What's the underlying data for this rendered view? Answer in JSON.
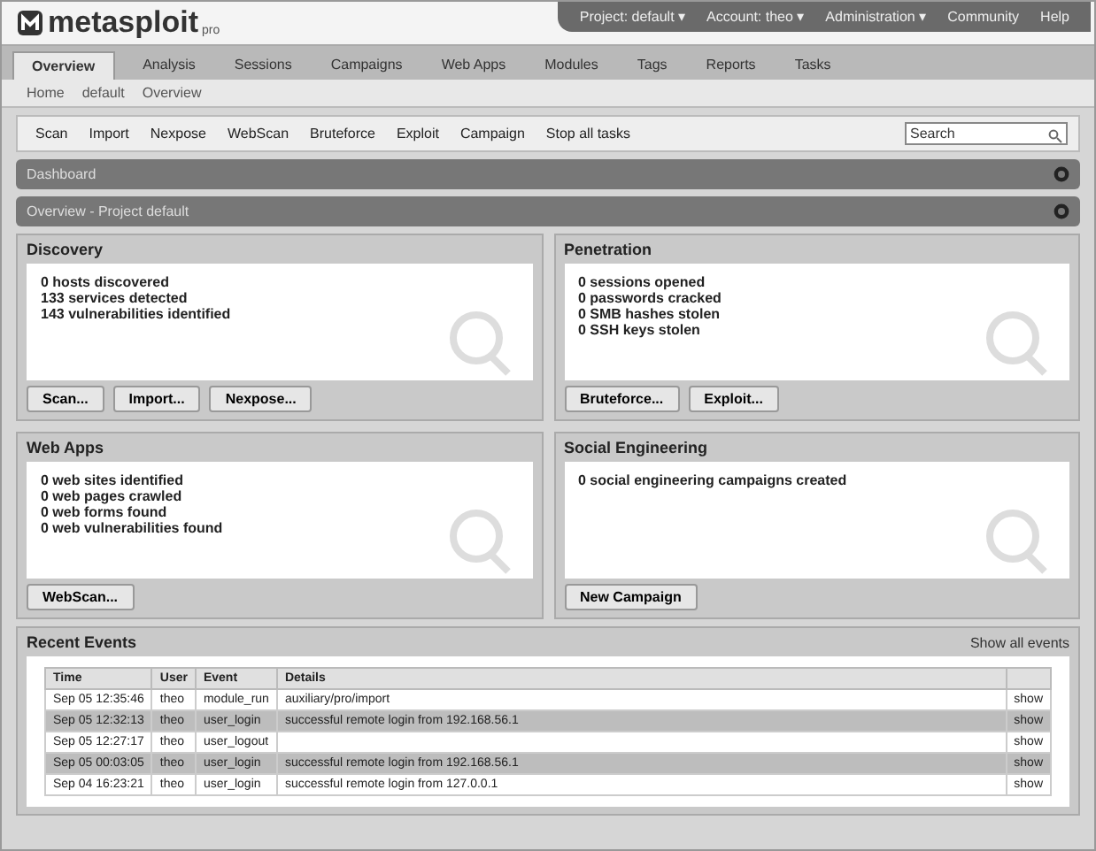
{
  "logo": {
    "name": "metasploit",
    "edition": "pro"
  },
  "top_menu": [
    "Project: default ▾",
    "Account: theo ▾",
    "Administration ▾",
    "Community",
    "Help"
  ],
  "nav_tabs": [
    {
      "label": "Overview",
      "selected": true
    },
    {
      "label": "Analysis",
      "selected": false
    },
    {
      "label": "Sessions",
      "selected": false
    },
    {
      "label": "Campaigns",
      "selected": false
    },
    {
      "label": "Web Apps",
      "selected": false
    },
    {
      "label": "Modules",
      "selected": false
    },
    {
      "label": "Tags",
      "selected": false
    },
    {
      "label": "Reports",
      "selected": false
    },
    {
      "label": "Tasks",
      "selected": false
    }
  ],
  "breadcrumb": [
    "Home",
    "default",
    "Overview"
  ],
  "toolbar": [
    "Scan",
    "Import",
    "Nexpose",
    "WebScan",
    "Bruteforce",
    "Exploit",
    "Campaign",
    "Stop all tasks"
  ],
  "search": {
    "placeholder": "Search"
  },
  "bars": [
    "Dashboard",
    "Overview - Project default"
  ],
  "panels": [
    {
      "title": "Discovery",
      "stats": [
        "0 hosts discovered",
        "133 services detected",
        "143 vulnerabilities identified"
      ],
      "buttons": [
        "Scan...",
        "Import...",
        "Nexpose..."
      ]
    },
    {
      "title": "Penetration",
      "stats": [
        "0 sessions opened",
        "0 passwords cracked",
        "0 SMB hashes stolen",
        "0 SSH keys stolen"
      ],
      "buttons": [
        "Bruteforce...",
        "Exploit..."
      ]
    },
    {
      "title": "Web Apps",
      "stats": [
        "0 web sites identified",
        "0 web pages crawled",
        "0 web forms found",
        "0 web vulnerabilities found"
      ],
      "buttons": [
        "WebScan..."
      ]
    },
    {
      "title": "Social Engineering",
      "stats": [
        "0 social engineering campaigns created"
      ],
      "buttons": [
        "New Campaign"
      ]
    }
  ],
  "recent_events": {
    "title": "Recent Events",
    "link": "Show all events",
    "columns": [
      "Time",
      "User",
      "Event",
      "Details"
    ],
    "rows": [
      {
        "time": "Sep 05 12:35:46",
        "user": "theo",
        "event": "module_run",
        "details": "auxiliary/pro/import",
        "action": "show"
      },
      {
        "time": "Sep 05 12:32:13",
        "user": "theo",
        "event": "user_login",
        "details": "successful remote login from 192.168.56.1",
        "action": "show"
      },
      {
        "time": "Sep 05 12:27:17",
        "user": "theo",
        "event": "user_logout",
        "details": "",
        "action": "show"
      },
      {
        "time": "Sep 05 00:03:05",
        "user": "theo",
        "event": "user_login",
        "details": "successful remote login from 192.168.56.1",
        "action": "show"
      },
      {
        "time": "Sep 04 16:23:21",
        "user": "theo",
        "event": "user_login",
        "details": "successful remote login from 127.0.0.1",
        "action": "show"
      }
    ]
  }
}
